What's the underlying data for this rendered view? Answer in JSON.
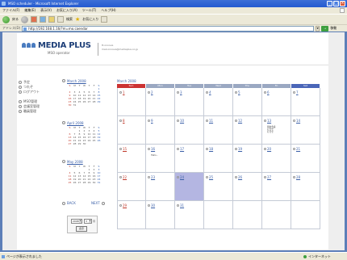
{
  "window": {
    "title": "MSO scheduler - Microsoft Internet Explorer",
    "buttons": [
      "_",
      "□",
      "×"
    ]
  },
  "menu": [
    "ファイル(F)",
    "編集(E)",
    "表示(V)",
    "お気に入り(A)",
    "ツール(T)",
    "ヘルプ(H)"
  ],
  "toolbar": {
    "back_label": "戻る",
    "search_label": "検索",
    "favorites_label": "お気に入り"
  },
  "address": {
    "label": "アドレス(D)",
    "url": "http://192.168.1.16/?m=mo.caendar",
    "go_label": "移動"
  },
  "header": {
    "brand": "MEDIA PLUS",
    "subtitle": "MSO operator",
    "user_name": "tt.onoove",
    "user_email": "mail.onoove@mediaplus.co.jp"
  },
  "nav": [
    {
      "label": "予定"
    },
    {
      "label": "つれぞ"
    },
    {
      "label": "ログアウト"
    },
    {
      "label": "MSO管理"
    },
    {
      "label": "会議室管理"
    },
    {
      "label": "職員管理"
    }
  ],
  "mini_calendars": [
    {
      "title": "March 2008",
      "weekdays": [
        "S",
        "M",
        "T",
        "W",
        "T",
        "F",
        "S"
      ],
      "rows": [
        [
          "",
          "",
          "",
          "",
          "",
          "",
          "1"
        ],
        [
          "2",
          "3",
          "4",
          "5",
          "6",
          "7",
          "8"
        ],
        [
          "9",
          "10",
          "11",
          "12",
          "13",
          "14",
          "15"
        ],
        [
          "16",
          "17",
          "18",
          "19",
          "20",
          "21",
          "22"
        ],
        [
          "23",
          "24",
          "25",
          "26",
          "27",
          "28",
          "29"
        ],
        [
          "30",
          "31",
          "",
          "",
          "",
          "",
          ""
        ]
      ]
    },
    {
      "title": "April 2008",
      "weekdays": [
        "S",
        "M",
        "T",
        "W",
        "T",
        "F",
        "S"
      ],
      "rows": [
        [
          "",
          "",
          "1",
          "2",
          "3",
          "4",
          "5"
        ],
        [
          "6",
          "7",
          "8",
          "9",
          "10",
          "11",
          "12"
        ],
        [
          "13",
          "14",
          "15",
          "16",
          "17",
          "18",
          "19"
        ],
        [
          "20",
          "21",
          "22",
          "23",
          "24",
          "25",
          "26"
        ],
        [
          "27",
          "28",
          "29",
          "30",
          "",
          "",
          ""
        ]
      ]
    },
    {
      "title": "May 2008",
      "weekdays": [
        "S",
        "M",
        "T",
        "W",
        "T",
        "F",
        "S"
      ],
      "rows": [
        [
          "",
          "",
          "",
          "",
          "1",
          "2",
          "3"
        ],
        [
          "4",
          "5",
          "6",
          "7",
          "8",
          "9",
          "10"
        ],
        [
          "11",
          "12",
          "13",
          "14",
          "15",
          "16",
          "17"
        ],
        [
          "18",
          "19",
          "20",
          "21",
          "22",
          "23",
          "24"
        ],
        [
          "25",
          "26",
          "27",
          "28",
          "29",
          "30",
          "31"
        ]
      ]
    }
  ],
  "cal_nav": {
    "back": "BACK",
    "next": "NEXT"
  },
  "jump": {
    "year": "2008",
    "month": "3",
    "month_suffix": "月",
    "button": "表示"
  },
  "main": {
    "month_title": "March 2008",
    "weekdays": [
      "Sun",
      "Mon",
      "Tue",
      "Wed",
      "Thu",
      "Fri",
      "Sat"
    ],
    "weeks": [
      [
        {
          "d": "1"
        },
        {
          "d": "2"
        },
        {
          "d": "3"
        },
        {
          "d": "4"
        },
        {
          "d": "5"
        },
        {
          "d": "6"
        },
        {
          "d": "7"
        }
      ],
      [
        {
          "d": "8"
        },
        {
          "d": "9"
        },
        {
          "d": "10"
        },
        {
          "d": "11"
        },
        {
          "d": "12"
        },
        {
          "d": "13",
          "events": [
            "朝倉会議",
            "打合せ",
            "打合せ"
          ]
        },
        {
          "d": "14"
        }
      ],
      [
        {
          "d": "15"
        },
        {
          "d": "16",
          "events": [
            "Hallo..."
          ]
        },
        {
          "d": "17"
        },
        {
          "d": "18"
        },
        {
          "d": "19"
        },
        {
          "d": "20"
        },
        {
          "d": "21"
        }
      ],
      [
        {
          "d": "22"
        },
        {
          "d": "23"
        },
        {
          "d": "24",
          "today": true
        },
        {
          "d": "25"
        },
        {
          "d": "26"
        },
        {
          "d": "27"
        },
        {
          "d": "28"
        }
      ],
      [
        {
          "d": "29"
        },
        {
          "d": "30"
        },
        {
          "d": "31"
        },
        {
          "d": ""
        },
        {
          "d": ""
        },
        {
          "d": ""
        },
        {
          "d": ""
        }
      ]
    ]
  },
  "status": {
    "left": "ページが表示されました",
    "right": "インターネット"
  },
  "colors": {
    "today_cell": "#b4b6e2",
    "sunday_header": "#cc3333",
    "saturday_header": "#4a66b8",
    "link_blue": "#3a5fa8",
    "brand_blue": "#1e3f78"
  }
}
